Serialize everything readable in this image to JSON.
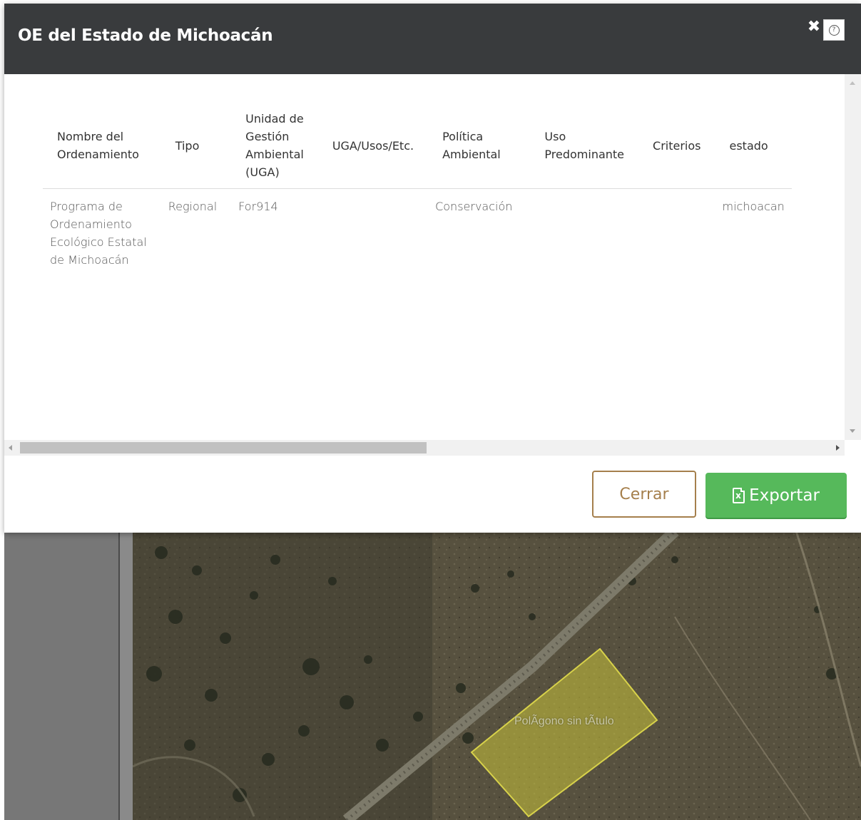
{
  "modal": {
    "title": "OE del Estado de Michoacán",
    "close_icon": "close-icon",
    "help_icon": "help-icon"
  },
  "table": {
    "headers": [
      [
        "Nombre del",
        "Ordenamiento"
      ],
      [
        "Tipo"
      ],
      [
        "Unidad de",
        "Gestión",
        "Ambiental",
        "(UGA)"
      ],
      [
        "UGA/Usos/Etc."
      ],
      [
        "Política",
        "Ambiental"
      ],
      [
        "Uso",
        "Predominante"
      ],
      [
        "Criterios"
      ],
      [
        "estado"
      ]
    ],
    "rows": [
      [
        [
          "Programa de",
          "Ordenamiento",
          "Ecológico Estatal",
          "de Michoacán"
        ],
        [
          "Regional"
        ],
        [
          "For914"
        ],
        [
          ""
        ],
        [
          "Conservación"
        ],
        [
          ""
        ],
        [
          ""
        ],
        [
          "michoacan"
        ]
      ]
    ]
  },
  "footer": {
    "cerrar_label": "Cerrar",
    "exportar_label": "Exportar",
    "exportar_icon": "excel-file-icon"
  },
  "map": {
    "polygon_label": "PolÃgono sin tÃtulo",
    "polygon_color": "#c8c23a"
  },
  "colors": {
    "header_bg": "#393b3d",
    "cerrar_border": "#a57f4c",
    "exportar_bg": "#56b95b"
  }
}
